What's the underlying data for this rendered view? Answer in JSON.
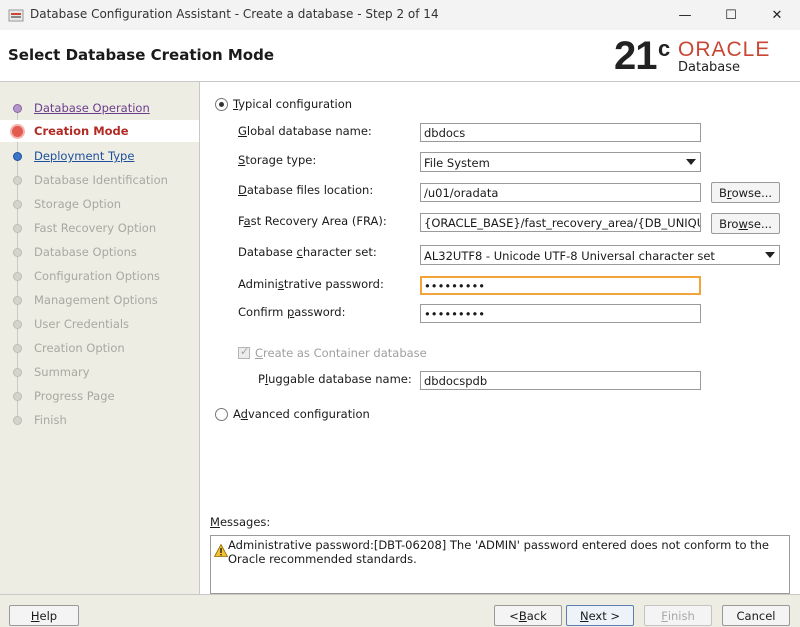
{
  "window": {
    "title": "Database Configuration Assistant - Create a database - Step 2 of 14",
    "minimize_glyph": "—",
    "maximize_glyph": "☐",
    "close_glyph": "✕"
  },
  "header": {
    "page_title": "Select Database Creation Mode",
    "brand_version": "21",
    "brand_version_sup": "c",
    "brand_name": "ORACLE",
    "brand_product": "Database"
  },
  "sidebar": {
    "steps": [
      {
        "label": "Database Operation",
        "state": "done"
      },
      {
        "label": "Creation Mode",
        "state": "current"
      },
      {
        "label": "Deployment Type",
        "state": "next"
      },
      {
        "label": "Database Identification",
        "state": "disabled"
      },
      {
        "label": "Storage Option",
        "state": "disabled"
      },
      {
        "label": "Fast Recovery Option",
        "state": "disabled"
      },
      {
        "label": "Database Options",
        "state": "disabled"
      },
      {
        "label": "Configuration Options",
        "state": "disabled"
      },
      {
        "label": "Management Options",
        "state": "disabled"
      },
      {
        "label": "User Credentials",
        "state": "disabled"
      },
      {
        "label": "Creation Option",
        "state": "disabled"
      },
      {
        "label": "Summary",
        "state": "disabled"
      },
      {
        "label": "Progress Page",
        "state": "disabled"
      },
      {
        "label": "Finish",
        "state": "disabled"
      }
    ]
  },
  "form": {
    "typical_label_mn": "T",
    "typical_label_rest": "ypical configuration",
    "global_db_name_label_mn": "G",
    "global_db_name_label_rest": "lobal database name:",
    "global_db_name_value": "dbdocs",
    "storage_type_label_mn": "S",
    "storage_type_label_rest": "torage type:",
    "storage_type_value": "File System",
    "db_files_location_label_mn": "D",
    "db_files_location_label_rest": "atabase files location:",
    "db_files_location_value": "/u01/oradata",
    "fra_label_pre": "F",
    "fra_label_mn": "a",
    "fra_label_rest": "st Recovery Area (FRA):",
    "fra_value": "{ORACLE_BASE}/fast_recovery_area/{DB_UNIQU",
    "charset_label_pre": "Database ",
    "charset_label_mn": "c",
    "charset_label_rest": "haracter set:",
    "charset_value": "AL32UTF8 - Unicode UTF-8 Universal character set",
    "admin_pw_label_pre": "Admini",
    "admin_pw_label_mn": "s",
    "admin_pw_label_rest": "trative password:",
    "admin_pw_value": "•••••••••",
    "confirm_pw_label_pre": "Confirm ",
    "confirm_pw_label_mn": "p",
    "confirm_pw_label_rest": "assword:",
    "confirm_pw_value": "•••••••••",
    "container_label_mn": "C",
    "container_label_rest": "reate as Container database",
    "pdb_name_label_pre": "P",
    "pdb_name_label_mn": "l",
    "pdb_name_label_rest": "uggable database name:",
    "pdb_name_value": "dbdocspdb",
    "advanced_label_pre": "A",
    "advanced_label_mn": "d",
    "advanced_label_rest": "vanced configuration",
    "browse_label_pre": "B",
    "browse_label_mn": "r",
    "browse_label_rest": "owse...",
    "browse2_label_pre": "Bro",
    "browse2_label_mn": "w",
    "browse2_label_rest": "se..."
  },
  "messages": {
    "label_pre": "",
    "label_mn": "M",
    "label_rest": "essages:",
    "text": "Administrative password:[DBT-06208] The 'ADMIN' password entered does not conform to the Oracle recommended standards."
  },
  "footer": {
    "help_mn": "H",
    "help_rest": "elp",
    "back_pre": "< ",
    "back_mn": "B",
    "back_rest": "ack",
    "next_mn": "N",
    "next_rest": "ext >",
    "finish_mn": "F",
    "finish_rest": "inish",
    "cancel": "Cancel"
  },
  "colors": {
    "accent_current": "#b22a25",
    "done_step": "#6b3d8c",
    "next_step": "#1d4f9c",
    "oracle_red": "#c74634",
    "focus_border": "#f2a43a"
  }
}
